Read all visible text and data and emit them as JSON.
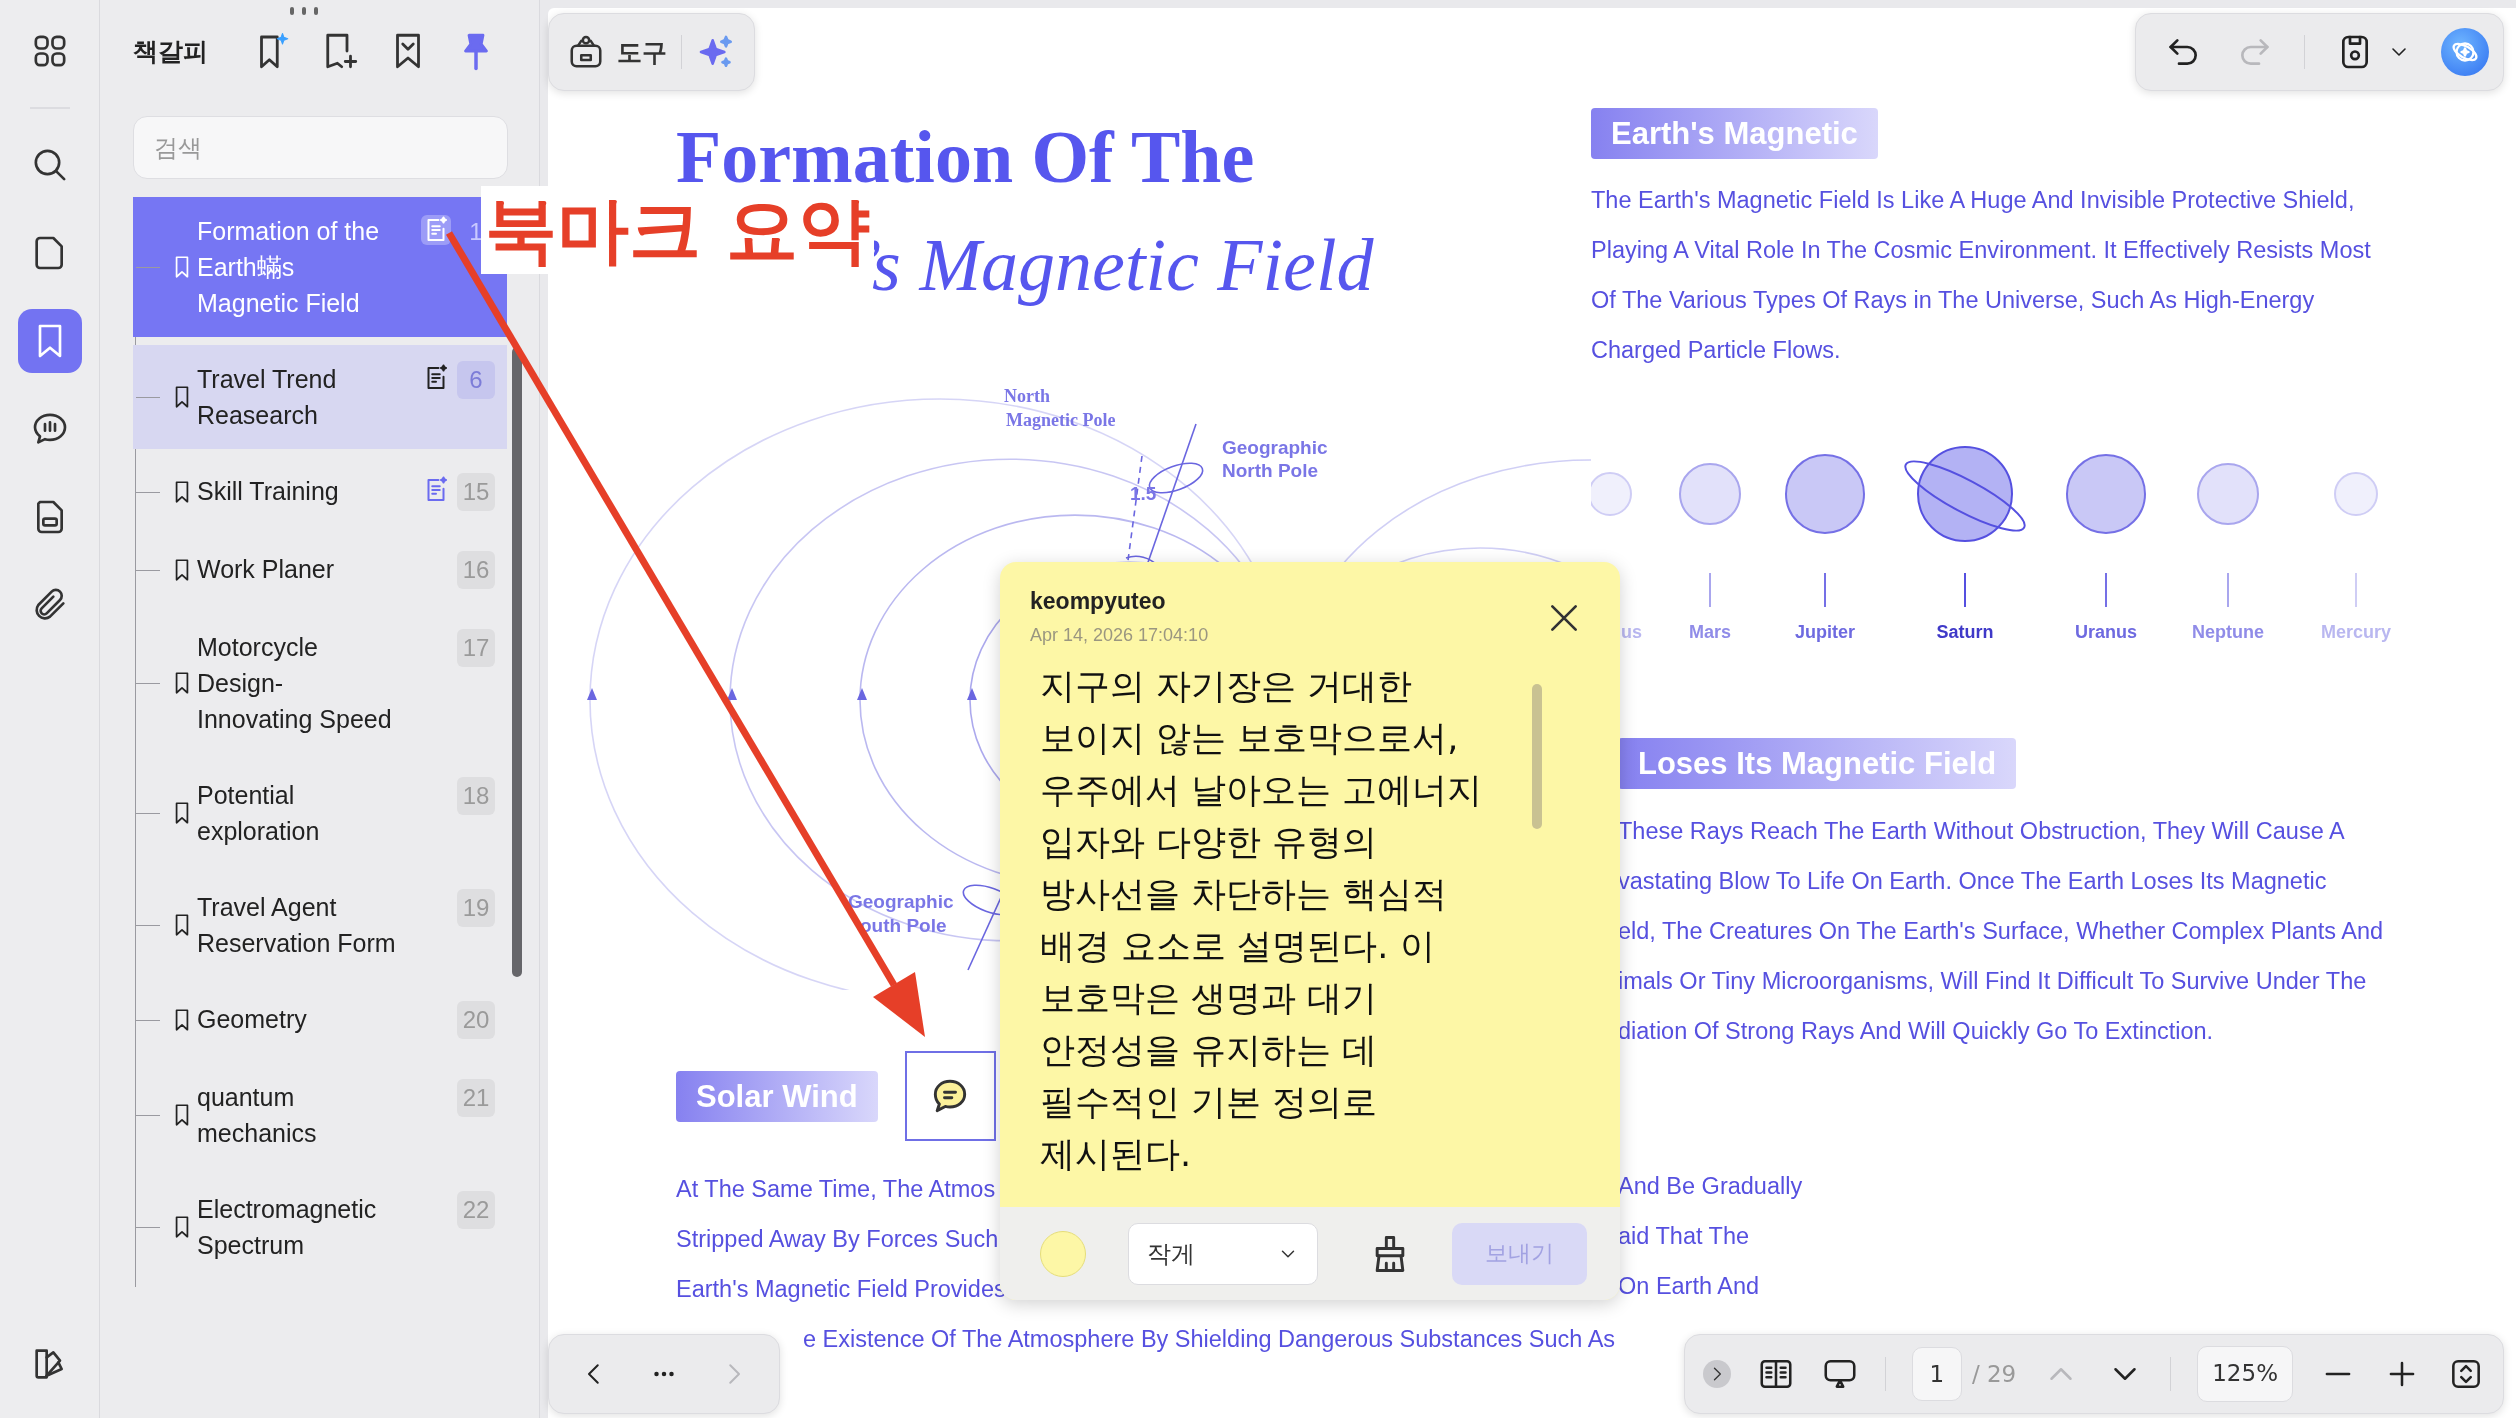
{
  "rail": {
    "items": [
      {
        "kind": "apps",
        "selected": false
      },
      {
        "kind": "search",
        "selected": false
      },
      {
        "kind": "pages",
        "selected": false
      },
      {
        "kind": "bookmarks",
        "selected": true
      },
      {
        "kind": "comments",
        "selected": false
      },
      {
        "kind": "forms",
        "selected": false
      },
      {
        "kind": "attachments",
        "selected": false
      }
    ],
    "footer": [
      {
        "kind": "theme",
        "selected": false
      }
    ]
  },
  "sidebar": {
    "title": "책갈피",
    "tools": [
      {
        "kind": "ai-bookmark",
        "on": false
      },
      {
        "kind": "add-bookmark",
        "on": false
      },
      {
        "kind": "collapse",
        "on": false
      },
      {
        "kind": "pin",
        "on": true
      }
    ],
    "search": {
      "placeholder": "검색"
    },
    "bookmarks": [
      {
        "title": "Formation of the Earth蟎s Magnetic Field",
        "page": "1",
        "summary": true,
        "selected": true,
        "hovered": false
      },
      {
        "title": "Travel Trend Reasearch",
        "page": "6",
        "summary": true,
        "selected": false,
        "hovered": true
      },
      {
        "title": "Skill Training",
        "page": "15",
        "summary": true,
        "selected": false,
        "hovered": false
      },
      {
        "title": "Work Planer",
        "page": "16",
        "summary": false,
        "selected": false,
        "hovered": false
      },
      {
        "title": "Motorcycle Design-Innovating Speed",
        "page": "17",
        "summary": false,
        "selected": false,
        "hovered": false
      },
      {
        "title": "Potential exploration",
        "page": "18",
        "summary": false,
        "selected": false,
        "hovered": false
      },
      {
        "title": "Travel Agent Reservation Form",
        "page": "19",
        "summary": false,
        "selected": false,
        "hovered": false
      },
      {
        "title": "Geometry",
        "page": "20",
        "summary": false,
        "selected": false,
        "hovered": false
      },
      {
        "title": "quantum mechanics",
        "page": "21",
        "summary": false,
        "selected": false,
        "hovered": false
      },
      {
        "title": "Electromagnetic Spectrum",
        "page": "22",
        "summary": false,
        "selected": false,
        "hovered": false
      }
    ]
  },
  "tools_bar": {
    "label": "도구"
  },
  "top_actions": [
    {
      "kind": "undo",
      "disabled": false
    },
    {
      "kind": "redo",
      "disabled": true
    },
    {
      "kind": "save",
      "disabled": false
    },
    {
      "kind": "dropdown",
      "disabled": false
    },
    {
      "kind": "assistant"
    }
  ],
  "annotation": {
    "label": "북마크 요약"
  },
  "document": {
    "title_line_1": "Formation Of The",
    "title_line_2": "’s Magnetic Field",
    "diagram_labels": {
      "north_magnetic": [
        "North",
        "Magnetic Pole"
      ],
      "north_geo": [
        "Geographic",
        "North Pole"
      ],
      "angle": "1.5",
      "south_geo": [
        "Geographic",
        "outh Pole"
      ]
    },
    "section_1": {
      "heading": "Earth's Magnetic",
      "lines": [
        "The Earth's Magnetic Field Is Like A Huge And Invisible Protective Shield,",
        "Playing A Vital Role In The Cosmic Environment. It Effectively Resists Most",
        "Of The Various Types Of Rays in The Universe, Such As High-Energy",
        "Charged Particle Flows."
      ]
    },
    "planets": [
      {
        "label": "us",
        "kind": "plain",
        "selected": false
      },
      {
        "label": "Mars",
        "kind": "plain",
        "selected": false
      },
      {
        "label": "Jupiter",
        "kind": "plain",
        "selected": false
      },
      {
        "label": "Saturn",
        "kind": "ringed",
        "selected": true
      },
      {
        "label": "Uranus",
        "kind": "plain",
        "selected": false
      },
      {
        "label": "Neptune",
        "kind": "plain",
        "selected": false
      },
      {
        "label": "Mercury",
        "kind": "plain",
        "selected": false
      }
    ],
    "section_2": {
      "heading": "Loses Its Magnetic Field",
      "lines": [
        "These Rays Reach The Earth Without Obstruction, They Will Cause A",
        "vastating Blow To Life On Earth. Once The Earth Loses Its Magnetic",
        "eld, The Creatures On The Earth's Surface, Whether Complex Plants And",
        "imals Or Tiny Microorganisms, Will Find It Difficult To Survive Under The",
        "diation Of Strong Rays And Will Quickly Go To Extinction."
      ]
    },
    "section_3": {
      "heading": "Solar Wind",
      "left_lines": [
        "At The Same Time, The Atmos",
        "Stripped Away By Forces Such",
        "Earth's Magnetic Field Provides"
      ],
      "right_lines": [
        "And Be Gradually",
        "aid That The",
        "On Earth And"
      ],
      "last_line": "e Existence Of The Atmosphere By Shielding Dangerous Substances Such As"
    }
  },
  "note": {
    "author": "keompyuteo",
    "date": "Apr 14, 2026 17:04:10",
    "body": "지구의 자기장은 거대한 보이지 않는 보호막으로서, 우주에서 날아오는 고에너지 입자와 다양한 유형의 방사선을 차단하는 핵심적 배경 요소로 설명된다. 이 보호막은 생명과 대기 안정성을 유지하는 데 필수적인 기본 정의로 제시된다.",
    "color": "#fdf7a6",
    "font_size": "작게",
    "send_label": "보내기",
    "send_disabled": true
  },
  "page_nav": [
    {
      "kind": "prev",
      "disabled": false
    },
    {
      "kind": "more",
      "disabled": false
    },
    {
      "kind": "next",
      "disabled": true
    }
  ],
  "view_bar": {
    "page": "1",
    "total": "/ 29",
    "zoom": "125%",
    "prev_page_disabled": true,
    "next_page_disabled": false
  }
}
